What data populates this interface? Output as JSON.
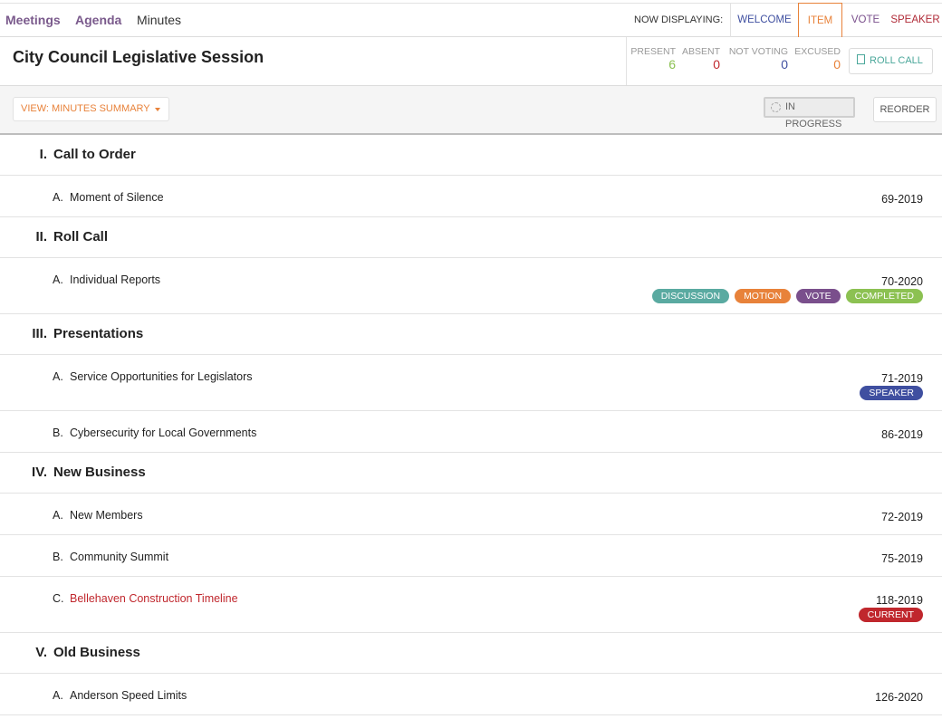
{
  "nav": {
    "tabs": [
      {
        "label": "Meetings"
      },
      {
        "label": "Agenda"
      },
      {
        "label": "Minutes"
      }
    ],
    "now_displaying_label": "NOW DISPLAYING:",
    "display_options": [
      {
        "label": "WELCOME",
        "color": "#3f4fa0"
      },
      {
        "label": "ITEM",
        "color": "#e8823a"
      },
      {
        "label": "VOTE",
        "color": "#7a4f8c"
      },
      {
        "label": "SPEAKER",
        "color": "#b02a37"
      }
    ]
  },
  "header": {
    "title": "City Council Legislative Session",
    "counts": [
      {
        "label": "PRESENT",
        "value": "6",
        "color": "#8cc152"
      },
      {
        "label": "ABSENT",
        "value": "0",
        "color": "#c0272d"
      },
      {
        "label": "NOT VOTING",
        "value": "0",
        "color": "#3f4fa0"
      },
      {
        "label": "EXCUSED",
        "value": "0",
        "color": "#e8823a"
      }
    ],
    "roll_call_label": "ROLL CALL"
  },
  "toolbar": {
    "view_label": "VIEW: MINUTES SUMMARY",
    "status_label": "IN PROGRESS",
    "reorder_label": "REORDER"
  },
  "badge_colors": {
    "DISCUSSION": "#5aaaa1",
    "MOTION": "#e8823a",
    "VOTE": "#7a4f8c",
    "COMPLETED": "#8cc152",
    "SPEAKER": "#3f4fa0",
    "CURRENT": "#c0272d"
  },
  "sections": [
    {
      "num": "I.",
      "title": "Call to Order",
      "items": [
        {
          "letter": "A.",
          "title": "Moment of Silence",
          "number": "69-2019",
          "badges": []
        }
      ]
    },
    {
      "num": "II.",
      "title": "Roll Call",
      "items": [
        {
          "letter": "A.",
          "title": "Individual Reports",
          "number": "70-2020",
          "badges": [
            "DISCUSSION",
            "MOTION",
            "VOTE",
            "COMPLETED"
          ]
        }
      ]
    },
    {
      "num": "III.",
      "title": "Presentations",
      "items": [
        {
          "letter": "A.",
          "title": "Service Opportunities for Legislators",
          "number": "71-2019",
          "badges": [
            "SPEAKER"
          ]
        },
        {
          "letter": "B.",
          "title": "Cybersecurity for Local Governments",
          "number": "86-2019",
          "badges": []
        }
      ]
    },
    {
      "num": "IV.",
      "title": "New Business",
      "items": [
        {
          "letter": "A.",
          "title": "New Members",
          "number": "72-2019",
          "badges": []
        },
        {
          "letter": "B.",
          "title": "Community Summit",
          "number": "75-2019",
          "badges": []
        },
        {
          "letter": "C.",
          "title": "Bellehaven Construction Timeline",
          "number": "118-2019",
          "badges": [
            "CURRENT"
          ],
          "current": true
        }
      ]
    },
    {
      "num": "V.",
      "title": "Old Business",
      "items": [
        {
          "letter": "A.",
          "title": "Anderson Speed Limits",
          "number": "126-2020",
          "badges": []
        }
      ]
    }
  ]
}
